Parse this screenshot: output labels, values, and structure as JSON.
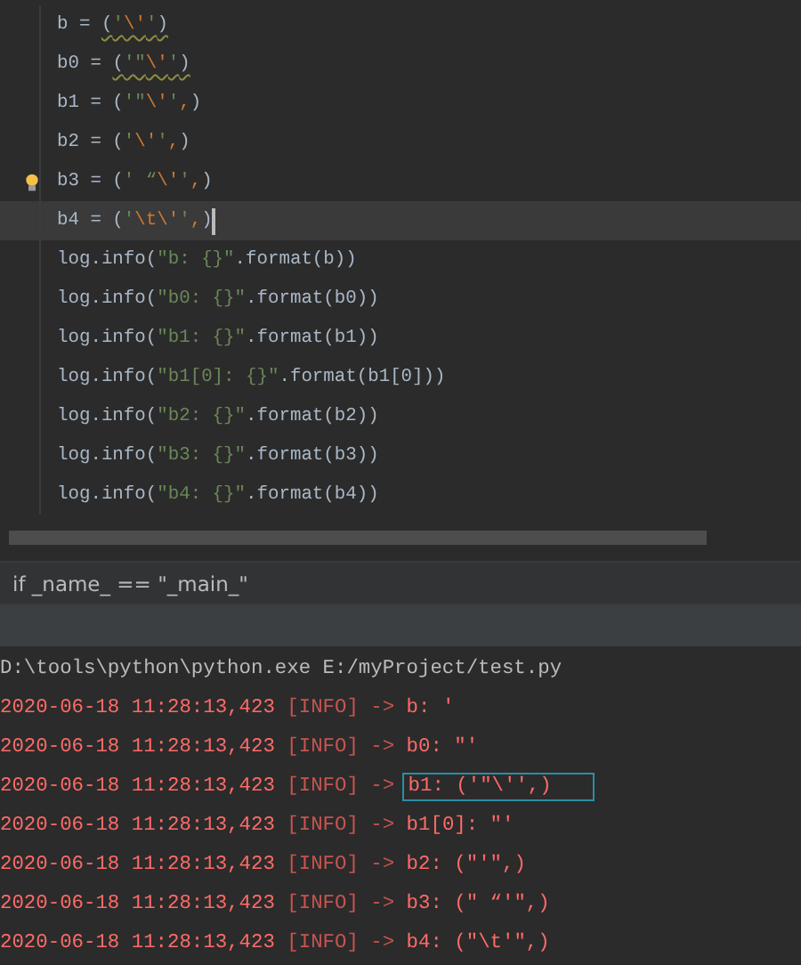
{
  "editor": {
    "lines": [
      {
        "warning": true,
        "bulb": false,
        "current": false,
        "caret": false,
        "tokens": [
          {
            "kind": "plain",
            "t": "b = "
          },
          {
            "kind": "plain",
            "t": "("
          },
          {
            "kind": "string",
            "t": "'"
          },
          {
            "kind": "escape",
            "t": "\\'"
          },
          {
            "kind": "string",
            "t": "'"
          },
          {
            "kind": "plain",
            "t": ")"
          }
        ]
      },
      {
        "warning": true,
        "bulb": false,
        "current": false,
        "caret": false,
        "tokens": [
          {
            "kind": "plain",
            "t": "b0 = "
          },
          {
            "kind": "plain",
            "t": "("
          },
          {
            "kind": "string",
            "t": "'\""
          },
          {
            "kind": "escape",
            "t": "\\'"
          },
          {
            "kind": "string",
            "t": "'"
          },
          {
            "kind": "plain",
            "t": ")"
          }
        ]
      },
      {
        "warning": false,
        "bulb": false,
        "current": false,
        "caret": false,
        "tokens": [
          {
            "kind": "plain",
            "t": "b1 = ("
          },
          {
            "kind": "string",
            "t": "'\""
          },
          {
            "kind": "escape",
            "t": "\\'"
          },
          {
            "kind": "string",
            "t": "'"
          },
          {
            "kind": "escape",
            "t": ","
          },
          {
            "kind": "plain",
            "t": ")"
          }
        ]
      },
      {
        "warning": false,
        "bulb": false,
        "current": false,
        "caret": false,
        "tokens": [
          {
            "kind": "plain",
            "t": "b2 = ("
          },
          {
            "kind": "string",
            "t": "'"
          },
          {
            "kind": "escape",
            "t": "\\'"
          },
          {
            "kind": "string",
            "t": "'"
          },
          {
            "kind": "escape",
            "t": ","
          },
          {
            "kind": "plain",
            "t": ")"
          }
        ]
      },
      {
        "warning": false,
        "bulb": true,
        "current": false,
        "caret": false,
        "tokens": [
          {
            "kind": "plain",
            "t": "b3 = ("
          },
          {
            "kind": "string",
            "t": "' “"
          },
          {
            "kind": "escape",
            "t": "\\'"
          },
          {
            "kind": "string",
            "t": "'"
          },
          {
            "kind": "escape",
            "t": ","
          },
          {
            "kind": "plain",
            "t": ")"
          }
        ]
      },
      {
        "warning": false,
        "bulb": false,
        "current": true,
        "caret": true,
        "tokens": [
          {
            "kind": "plain",
            "t": "b4 = ("
          },
          {
            "kind": "string",
            "t": "'"
          },
          {
            "kind": "escape",
            "t": "\\t\\'"
          },
          {
            "kind": "string",
            "t": "'"
          },
          {
            "kind": "escape",
            "t": ","
          },
          {
            "kind": "plain",
            "t": ")"
          }
        ]
      },
      {
        "warning": false,
        "bulb": false,
        "current": false,
        "caret": false,
        "tokens": [
          {
            "kind": "plain",
            "t": "log.info("
          },
          {
            "kind": "string",
            "t": "\"b: {}\""
          },
          {
            "kind": "plain",
            "t": ".format(b))"
          }
        ]
      },
      {
        "warning": false,
        "bulb": false,
        "current": false,
        "caret": false,
        "tokens": [
          {
            "kind": "plain",
            "t": "log.info("
          },
          {
            "kind": "string",
            "t": "\"b0: {}\""
          },
          {
            "kind": "plain",
            "t": ".format(b0))"
          }
        ]
      },
      {
        "warning": false,
        "bulb": false,
        "current": false,
        "caret": false,
        "tokens": [
          {
            "kind": "plain",
            "t": "log.info("
          },
          {
            "kind": "string",
            "t": "\"b1: {}\""
          },
          {
            "kind": "plain",
            "t": ".format(b1))"
          }
        ]
      },
      {
        "warning": false,
        "bulb": false,
        "current": false,
        "caret": false,
        "tokens": [
          {
            "kind": "plain",
            "t": "log.info("
          },
          {
            "kind": "string",
            "t": "\"b1[0]: {}\""
          },
          {
            "kind": "plain",
            "t": ".format(b1[0]))"
          }
        ]
      },
      {
        "warning": false,
        "bulb": false,
        "current": false,
        "caret": false,
        "tokens": [
          {
            "kind": "plain",
            "t": "log.info("
          },
          {
            "kind": "string",
            "t": "\"b2: {}\""
          },
          {
            "kind": "plain",
            "t": ".format(b2))"
          }
        ]
      },
      {
        "warning": false,
        "bulb": false,
        "current": false,
        "caret": false,
        "tokens": [
          {
            "kind": "plain",
            "t": "log.info("
          },
          {
            "kind": "string",
            "t": "\"b3: {}\""
          },
          {
            "kind": "plain",
            "t": ".format(b3))"
          }
        ]
      },
      {
        "warning": false,
        "bulb": false,
        "current": false,
        "caret": false,
        "tokens": [
          {
            "kind": "plain",
            "t": "log.info("
          },
          {
            "kind": "string",
            "t": "\"b4: {}\""
          },
          {
            "kind": "plain",
            "t": ".format(b4))"
          }
        ]
      }
    ]
  },
  "breadcrumb": "if _name_ == \"_main_\"",
  "console": {
    "lines": [
      {
        "kind": "command",
        "text": "D:\\tools\\python\\python.exe E:/myProject/test.py"
      },
      {
        "kind": "log",
        "time": "2020-06-18 11:28:13,423",
        "level": "[INFO] ->",
        "message": "b: '",
        "boxed": false
      },
      {
        "kind": "log",
        "time": "2020-06-18 11:28:13,423",
        "level": "[INFO] ->",
        "message": "b0: \"'",
        "boxed": false
      },
      {
        "kind": "log",
        "time": "2020-06-18 11:28:13,423",
        "level": "[INFO] ->",
        "message": "b1: ('\"\\'',)",
        "boxed": true
      },
      {
        "kind": "log",
        "time": "2020-06-18 11:28:13,423",
        "level": "[INFO] ->",
        "message": "b1[0]: \"'",
        "boxed": false
      },
      {
        "kind": "log",
        "time": "2020-06-18 11:28:13,423",
        "level": "[INFO] ->",
        "message": "b2: (\"'\",)",
        "boxed": false
      },
      {
        "kind": "log",
        "time": "2020-06-18 11:28:13,423",
        "level": "[INFO] ->",
        "message": "b3: (\" “'\",)",
        "boxed": false
      },
      {
        "kind": "log",
        "time": "2020-06-18 11:28:13,423",
        "level": "[INFO] ->",
        "message": "b4: (\"\\t'\",)",
        "boxed": false
      }
    ]
  }
}
